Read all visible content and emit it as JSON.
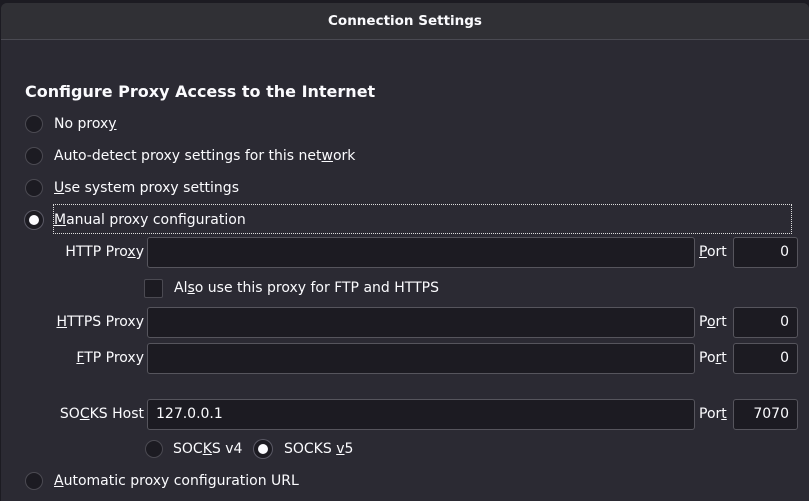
{
  "window": {
    "title": "Connection Settings"
  },
  "heading": "Configure Proxy Access to the Internet",
  "proxy_modes": [
    {
      "pre": "No prox",
      "key": "y",
      "post": "",
      "selected": false
    },
    {
      "pre": "Auto-detect proxy settings for this net",
      "key": "w",
      "post": "ork",
      "selected": false
    },
    {
      "pre": "",
      "key": "U",
      "post": "se system proxy settings",
      "selected": false
    },
    {
      "pre": "",
      "key": "M",
      "post": "anual proxy configuration",
      "selected": true
    },
    {
      "pre": "",
      "key": "A",
      "post": "utomatic proxy configuration URL",
      "selected": false
    }
  ],
  "http": {
    "label": {
      "pre": "HTTP Pro",
      "key": "x",
      "post": "y"
    },
    "value": "",
    "port_label": {
      "pre": "",
      "key": "P",
      "post": "ort"
    },
    "port": "0"
  },
  "also_use": {
    "label": {
      "pre": "Al",
      "key": "s",
      "post": "o use this proxy for FTP and HTTPS"
    },
    "checked": false
  },
  "https": {
    "label": {
      "pre": "",
      "key": "H",
      "post": "TTPS Proxy"
    },
    "value": "",
    "port_label": {
      "pre": "P",
      "key": "o",
      "post": "rt"
    },
    "port": "0"
  },
  "ftp": {
    "label": {
      "pre": "",
      "key": "F",
      "post": "TP Proxy"
    },
    "value": "",
    "port_label": {
      "pre": "Po",
      "key": "r",
      "post": "t"
    },
    "port": "0"
  },
  "socks": {
    "label": {
      "pre": "SO",
      "key": "C",
      "post": "KS Host"
    },
    "value": "127.0.0.1",
    "port_label": {
      "pre": "Por",
      "key": "t",
      "post": ""
    },
    "port": "7070"
  },
  "socks_versions": [
    {
      "pre": "SOC",
      "key": "K",
      "post": "S v4",
      "selected": false
    },
    {
      "pre": "SOCKS ",
      "key": "v",
      "post": "5",
      "selected": true
    }
  ]
}
